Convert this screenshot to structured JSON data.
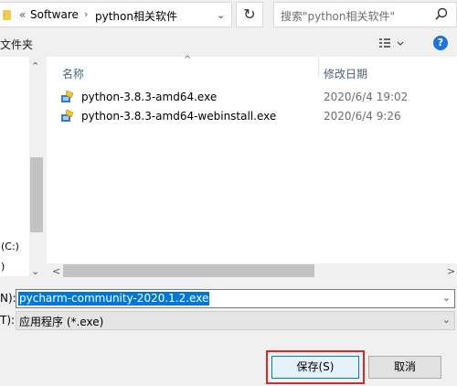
{
  "address": {
    "prefix": "«",
    "crumbs": [
      "Software",
      "python相关软件"
    ],
    "separator": "›",
    "dropdown": "⌄"
  },
  "refresh_icon": "↻",
  "search": {
    "placeholder": "搜索\"python相关软件\""
  },
  "toolbar": {
    "new_folder": "文件夹",
    "help": "?"
  },
  "navigation": {
    "items": [
      "(C:)",
      ")"
    ]
  },
  "columns": {
    "name": "名称",
    "date_modified": "修改日期"
  },
  "files": [
    {
      "name": "python-3.8.3-amd64.exe",
      "date": "2020/6/4 19:02"
    },
    {
      "name": "python-3.8.3-amd64-webinstall.exe",
      "date": "2020/6/4 9:26"
    }
  ],
  "filename": {
    "label": "N):",
    "value": "pycharm-community-2020.1.2.exe"
  },
  "filetype": {
    "label": "T):",
    "value": "应用程序 (*.exe)"
  },
  "buttons": {
    "save": "保存(S)",
    "cancel": "取消"
  },
  "colors": {
    "accent": "#0078d7",
    "highlight_border": "#d9262b",
    "help": "#1e74d9"
  }
}
